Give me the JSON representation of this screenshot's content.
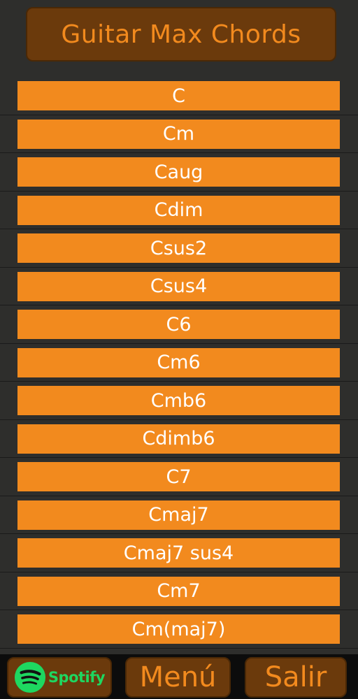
{
  "header": {
    "title": "Guitar Max Chords"
  },
  "chords": [
    {
      "label": "C"
    },
    {
      "label": "Cm"
    },
    {
      "label": "Caug"
    },
    {
      "label": "Cdim"
    },
    {
      "label": "Csus2"
    },
    {
      "label": "Csus4"
    },
    {
      "label": "C6"
    },
    {
      "label": "Cm6"
    },
    {
      "label": "Cmb6"
    },
    {
      "label": "Cdimb6"
    },
    {
      "label": "C7"
    },
    {
      "label": "Cmaj7"
    },
    {
      "label": "Cmaj7 sus4"
    },
    {
      "label": "Cm7"
    },
    {
      "label": "Cm(maj7)"
    }
  ],
  "bottom_bar": {
    "spotify": {
      "label": "Spotify",
      "icon": "spotify-icon",
      "color": "#1ed760"
    },
    "menu": {
      "label": "Menú"
    },
    "exit": {
      "label": "Salir"
    }
  },
  "colors": {
    "accent": "#f28a1e",
    "header_bg": "#6b3a0c",
    "background": "#2e2e2c",
    "bottom_bar_bg": "#0c0c0c"
  }
}
